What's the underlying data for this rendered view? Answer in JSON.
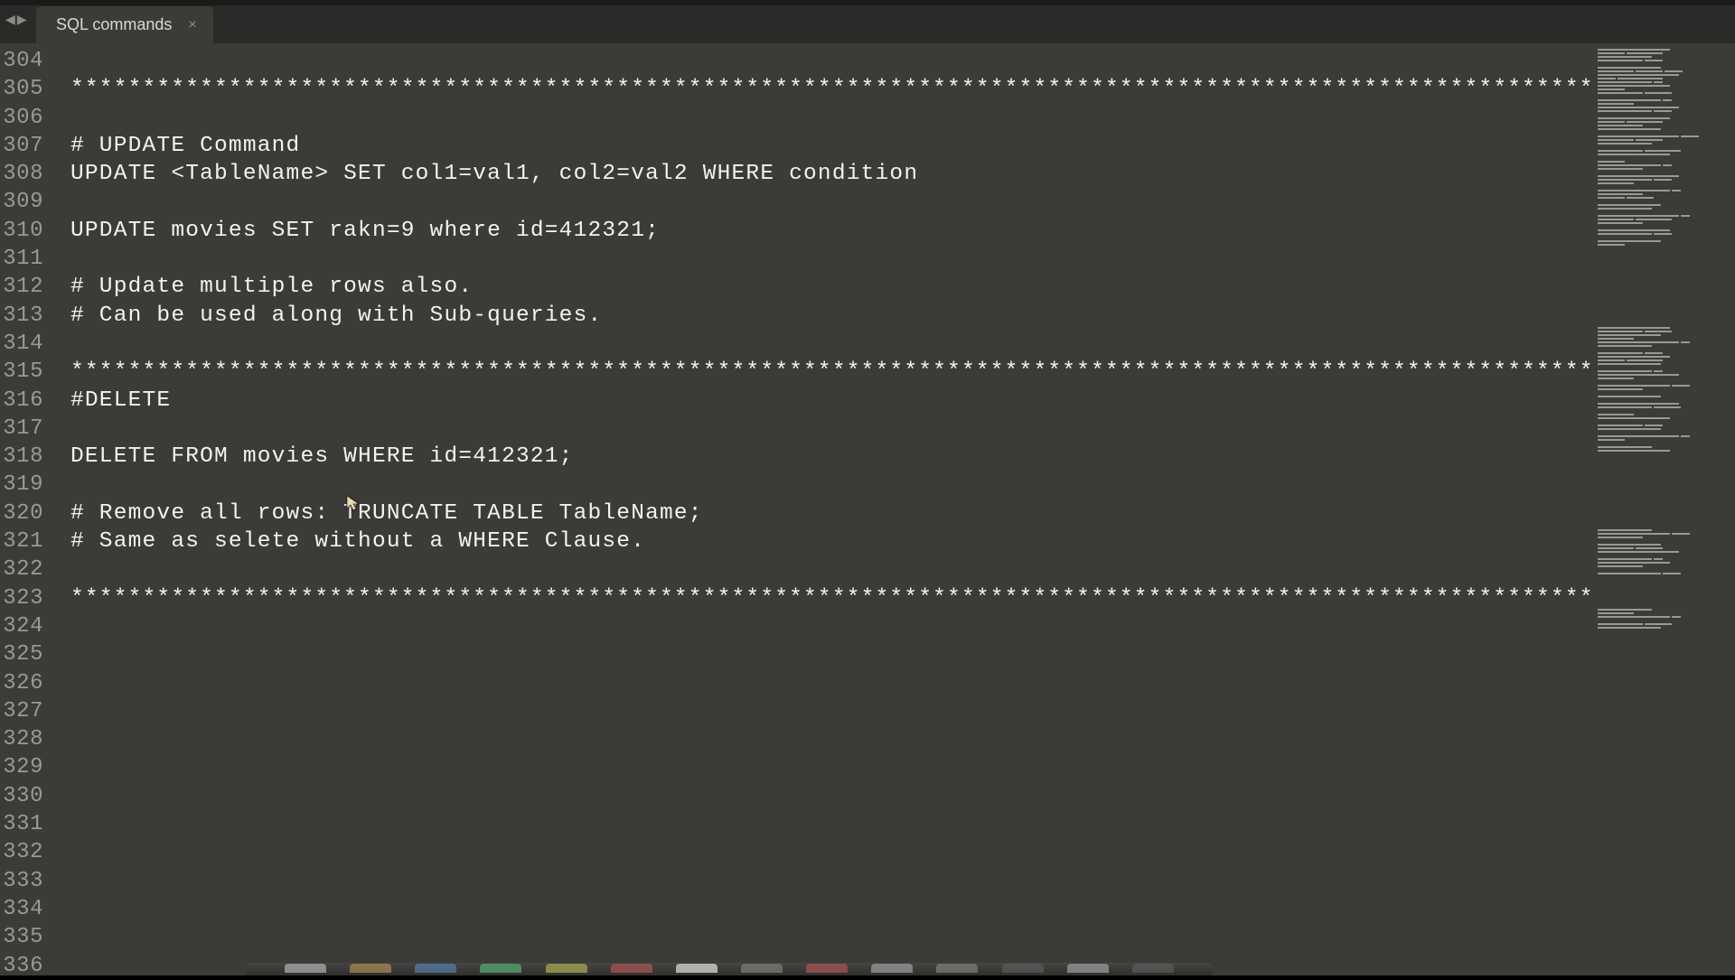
{
  "tab": {
    "title": "SQL commands"
  },
  "gutter": {
    "start": 304,
    "end": 336
  },
  "code_lines": [
    "",
    "***********************************************************************************************************",
    "",
    "# UPDATE Command",
    "UPDATE <TableName> SET col1=val1, col2=val2 WHERE condition",
    "",
    "UPDATE movies SET rakn=9 where id=412321;",
    "",
    "# Update multiple rows also.",
    "# Can be used along with Sub-queries.",
    "",
    "***********************************************************************************************************",
    "#DELETE",
    "",
    "DELETE FROM movies WHERE id=412321;",
    "",
    "# Remove all rows: TRUNCATE TABLE TableName;",
    "# Same as selete without a WHERE Clause.",
    "",
    "***********************************************************************************************************",
    "",
    "",
    "",
    "",
    "",
    "",
    "",
    "",
    "",
    "",
    "",
    "",
    ""
  ],
  "dock_colors": [
    "#c8c8c8",
    "#c29a5a",
    "#5a8ac2",
    "#5ac27a",
    "#c2c25a",
    "#c25a5a",
    "#ffffff",
    "#8a8a8a",
    "#c25a5a",
    "#b0b0b0",
    "#8a8a8a",
    "#606060",
    "#b0b0b0",
    "#606060"
  ]
}
